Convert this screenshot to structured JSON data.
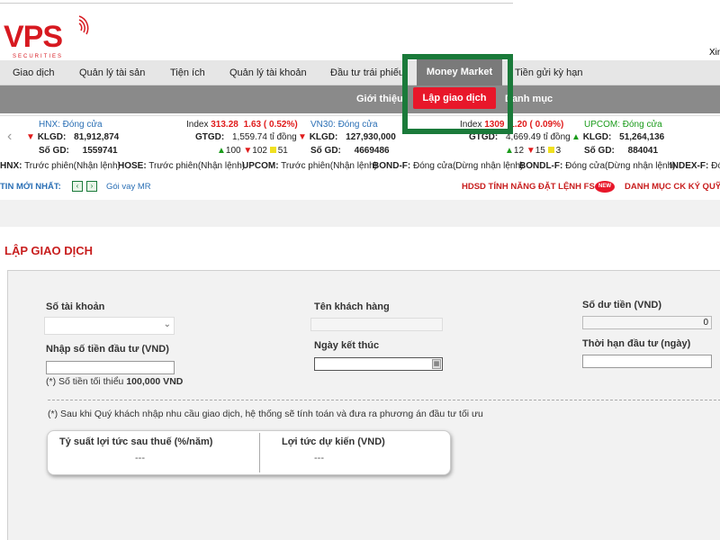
{
  "brand": {
    "logo_text": "VPS",
    "logo_sub": "SECURITIES",
    "greeting": "Xin"
  },
  "main_nav": [
    {
      "label": "Giao dịch"
    },
    {
      "label": "Quản lý tài sản"
    },
    {
      "label": "Tiện ích"
    },
    {
      "label": "Quản lý tài khoản"
    },
    {
      "label": "Đầu tư trái phiếu"
    },
    {
      "label": "Money Market",
      "active": true
    },
    {
      "label": "Tiền gửi kỳ hạn"
    }
  ],
  "sub_nav": [
    {
      "label": "Giới thiệu"
    },
    {
      "label": "Lập giao dịch",
      "active": true
    },
    {
      "label": "Danh mục"
    }
  ],
  "ticker": {
    "hnx": {
      "name": "HNX: Đóng cửa",
      "klgd_label": "KLGD:",
      "klgd": "81,912,874",
      "sogd_label": "Số GD:",
      "sogd": "1559741",
      "index_label": "Index",
      "index": "313.28",
      "change": "1.63",
      "pct": "( 0.52%)",
      "gtgd_label": "GTGD:",
      "gtgd": "1,559.74 tỉ đồng",
      "up": "100",
      "down": "102",
      "ref": "51"
    },
    "vn30": {
      "name": "VN30: Đóng cửa",
      "klgd_label": "KLGD:",
      "klgd": "127,930,000",
      "sogd_label": "Số GD:",
      "sogd": "4669486",
      "index_label": "Index",
      "index": "1309",
      "change": "1.20",
      "pct": "( 0.09%)",
      "gtgd_label": "GTGD:",
      "gtgd": "4,669.49 tỉ đồng",
      "up": "12",
      "down": "15",
      "ref": "3"
    },
    "upcom": {
      "name": "UPCOM: Đóng cửa",
      "klgd_label": "KLGD:",
      "klgd": "51,264,136",
      "sogd_label": "Số GD:",
      "sogd": "884041"
    }
  },
  "sessions": [
    {
      "market": "HNX:",
      "status": "Trước phiên(Nhận lệnh)"
    },
    {
      "market": "HOSE:",
      "status": "Trước phiên(Nhận lệnh)"
    },
    {
      "market": "UPCOM:",
      "status": "Trước phiên(Nhận lệnh)"
    },
    {
      "market": "BOND-F:",
      "status": "Đóng cửa(Dừng nhận lệnh)"
    },
    {
      "market": "BONDL-F:",
      "status": "Đóng cửa(Dừng nhận lệnh)"
    },
    {
      "market": "INDEX-F:",
      "status": "Đó"
    }
  ],
  "news": {
    "label": "TIN MỚI NHẤT:",
    "prev": "‹",
    "next": "›",
    "item": "Gói vay MR",
    "promo1": "HDSD TÍNH NĂNG ĐẶT LỆNH FS",
    "badge": "NEW",
    "promo2": "DANH MỤC CK KÝ QUỸ"
  },
  "page_title": "LẬP GIAO DỊCH",
  "form": {
    "account_label": "Số tài khoản",
    "account_value": "",
    "customer_label": "Tên khách hàng",
    "customer_value": "",
    "balance_label": "Số dư tiền (VND)",
    "balance_value": "0",
    "amount_label": "Nhập số tiền đầu tư (VND)",
    "amount_value": "",
    "min_note_prefix": "(*) Số tiền tối thiểu",
    "min_amount": "100,000 VND",
    "end_date_label": "Ngày kết thúc",
    "end_date_value": "",
    "term_label": "Thời hạn đầu tư (ngày)",
    "term_value": "",
    "system_note": "(*) Sau khi Quý khách nhập nhu cầu giao dịch, hệ thống sẽ tính toán và đưa ra phương án đầu tư tối ưu"
  },
  "results": {
    "rate_label": "Tỷ suất lợi tức sau thuế (%/năm)",
    "rate_value": "---",
    "yield_label": "Lợi tức dự kiến (VND)",
    "yield_value": "---"
  },
  "colors": {
    "brand_red": "#d71920",
    "highlight_green": "#1a7a3a",
    "subnav_grey": "#8a8a8a",
    "active_red": "#e8172a"
  }
}
